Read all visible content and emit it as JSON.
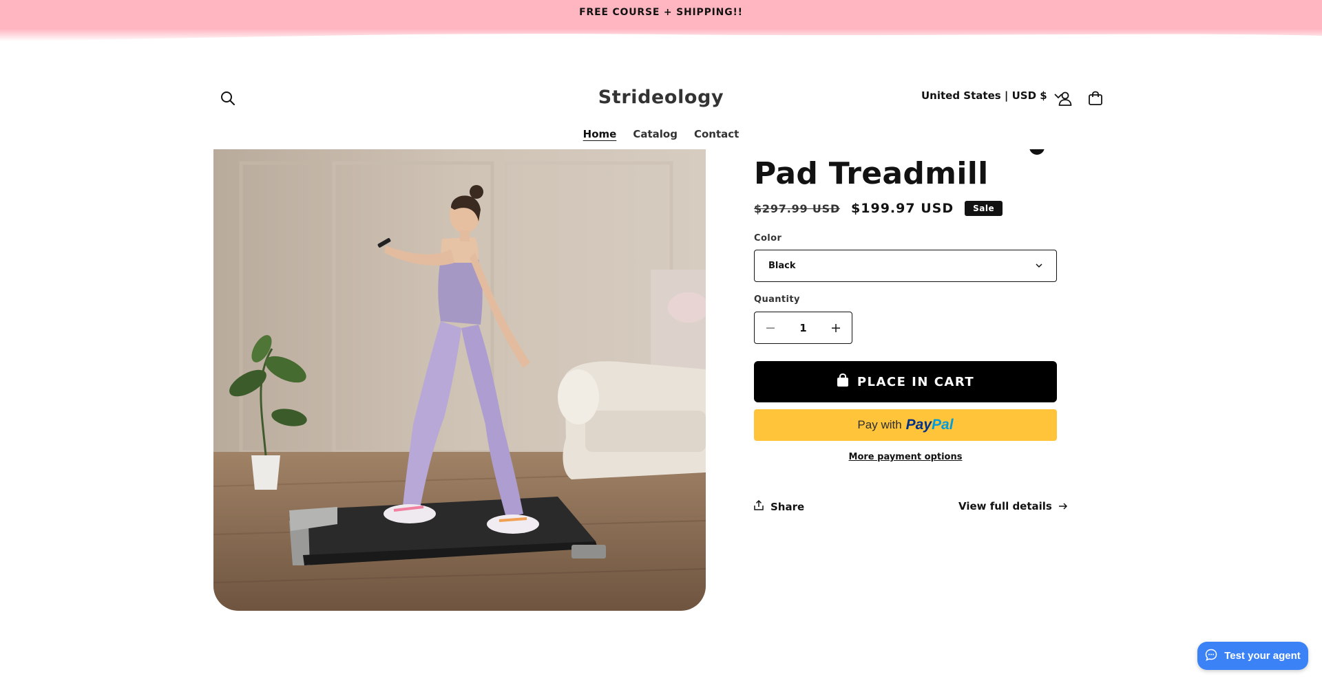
{
  "colors": {
    "announcement_bg": "#ffb6c1",
    "text": "#121212",
    "cart_button_bg": "#000000",
    "paypal_bg": "#ffc43a",
    "agent_button_bg": "#3b82f6"
  },
  "announcement": {
    "text": "FREE COURSE + SHIPPING!!"
  },
  "header": {
    "logo": "Strideology",
    "locale": "United States | USD $",
    "icons": [
      "search-icon",
      "account-icon",
      "cart-icon",
      "chevron-down-icon"
    ]
  },
  "nav": {
    "items": [
      {
        "label": "Home",
        "active": true
      },
      {
        "label": "Catalog",
        "active": false
      },
      {
        "label": "Contact",
        "active": false
      }
    ]
  },
  "product": {
    "title_visible": "Pad Treadmill",
    "price_compare": "$297.99 USD",
    "price": "$199.97 USD",
    "badge": "Sale",
    "color_label": "Color",
    "color_value": "Black",
    "quantity_label": "Quantity",
    "quantity_value": "1",
    "add_to_cart": "PLACE IN CART",
    "paypal": {
      "prefix": "Pay with",
      "brand_pay": "Pay",
      "brand_pal": "Pal"
    },
    "more_payment": "More payment options",
    "share": "Share",
    "view_details": "View full details"
  },
  "chat": {
    "label": "Test your agent"
  }
}
